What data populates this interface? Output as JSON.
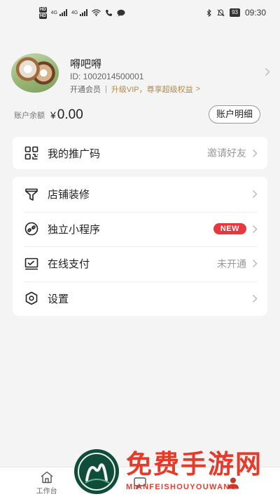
{
  "status_bar": {
    "hd1": "HD",
    "hd2": "HD",
    "net1": "4G",
    "net2": "4G",
    "battery": "93",
    "time": "09:30"
  },
  "profile": {
    "name": "嘚吧嘚",
    "id": "ID: 1002014500001",
    "member_label": "开通会员",
    "separator": "|",
    "vip_text": "升级VIP，尊享超级权益",
    "vip_arrow": ">"
  },
  "balance": {
    "label": "账户余额",
    "currency": "¥",
    "value": "0.00",
    "detail_button": "账户明细"
  },
  "menu_top": [
    {
      "label": "我的推广码",
      "right_text": "邀请好友",
      "icon": "qrcode-icon"
    }
  ],
  "menu_main": [
    {
      "label": "店铺装修",
      "right_text": "",
      "icon": "funnel-icon"
    },
    {
      "label": "独立小程序",
      "badge": "NEW",
      "icon": "link-icon"
    },
    {
      "label": "在线支付",
      "right_text": "未开通",
      "icon": "monitor-icon"
    },
    {
      "label": "设置",
      "right_text": "",
      "icon": "settings-icon"
    }
  ],
  "bottom_nav": [
    {
      "label": "工作台",
      "icon": "home-icon"
    },
    {
      "label": "",
      "icon": "chat-icon"
    },
    {
      "label": "",
      "icon": "user-icon"
    }
  ],
  "watermark": {
    "title": "免费手游网",
    "subtitle": "MIANFEISHOUYOUWANG"
  },
  "colors": {
    "background": "#f4f4f4",
    "vip_gold": "#b08a4a",
    "new_badge": "#e8383d",
    "watermark_red": "#e63a2a",
    "watermark_green": "#0f4d3a"
  }
}
